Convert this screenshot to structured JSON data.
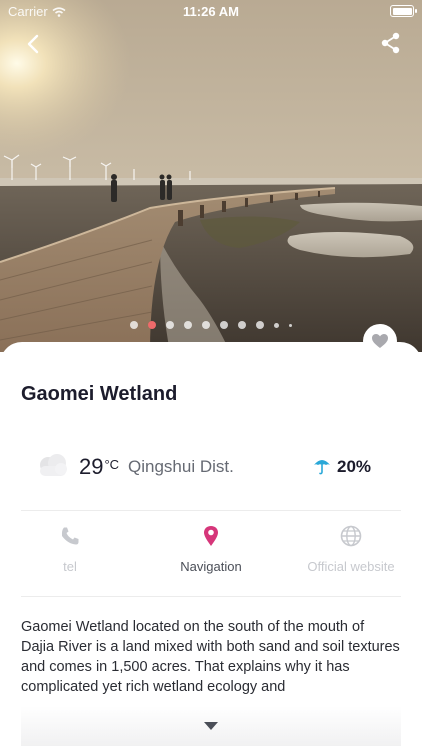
{
  "status_bar": {
    "carrier": "Carrier",
    "time": "11:26 AM"
  },
  "hero": {
    "photo": "wooden boardwalk over wetland at sunset with wind turbines",
    "slide_count": 10,
    "active_slide": 2
  },
  "place": {
    "title": "Gaomei Wetland"
  },
  "weather": {
    "icon": "cloud-icon",
    "temperature": "29",
    "unit": "°C",
    "district": "Qingshui Dist.",
    "rain_icon": "umbrella-icon",
    "rain_chance": "20%"
  },
  "actions": [
    {
      "label": "tel",
      "icon": "phone-icon",
      "enabled": false
    },
    {
      "label": "Navigation",
      "icon": "map-pin-icon",
      "enabled": true
    },
    {
      "label": "Official website",
      "icon": "globe-icon",
      "enabled": false
    }
  ],
  "description": "Gaomei Wetland located on the south of the mouth of Dajia River is a land mixed with both sand and soil textures and comes in 1,500 acres. That explains why it has complicated yet rich wetland ecology and",
  "colors": {
    "accent_pink": "#d6367a",
    "active_dot": "#ef6a6a",
    "umbrella_blue": "#2aa8d8",
    "disabled_gray": "#c7c9ce"
  }
}
